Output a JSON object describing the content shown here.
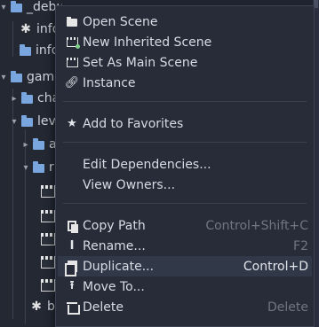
{
  "tree": {
    "rows": [
      {
        "label": "_debug",
        "icon": "folder-icon",
        "arrow": "▾"
      },
      {
        "label": "info",
        "icon": "gear-icon",
        "arrow": ""
      },
      {
        "label": "info",
        "icon": "folder-icon",
        "arrow": ""
      },
      {
        "label": "game",
        "icon": "folder-icon",
        "arrow": "▾"
      },
      {
        "label": "cha",
        "icon": "folder-icon",
        "arrow": "▸"
      },
      {
        "label": "lev",
        "icon": "folder-icon",
        "arrow": "▾"
      },
      {
        "label": "a",
        "icon": "folder-icon",
        "arrow": "▸"
      },
      {
        "label": "r",
        "icon": "folder-icon",
        "arrow": "▾"
      },
      {
        "label": "",
        "icon": "scene-icon",
        "arrow": ""
      },
      {
        "label": "",
        "icon": "scene-icon",
        "arrow": ""
      },
      {
        "label": "",
        "icon": "scene-icon",
        "arrow": ""
      },
      {
        "label": "",
        "icon": "scene-icon",
        "arrow": ""
      },
      {
        "label": "",
        "icon": "scene-icon",
        "arrow": ""
      },
      {
        "label": "b",
        "icon": "gear-icon",
        "arrow": ""
      }
    ]
  },
  "menu": {
    "items": [
      {
        "label": "Open Scene",
        "icon": "folder-open-icon",
        "shortcut": ""
      },
      {
        "label": "New Inherited Scene",
        "icon": "new-inherited-scene-icon",
        "shortcut": ""
      },
      {
        "label": "Set As Main Scene",
        "icon": "main-scene-icon",
        "shortcut": ""
      },
      {
        "label": "Instance",
        "icon": "link-icon",
        "shortcut": ""
      },
      {
        "label": "Add to Favorites",
        "icon": "star-icon",
        "shortcut": ""
      },
      {
        "label": "Edit Dependencies...",
        "icon": "",
        "shortcut": ""
      },
      {
        "label": "View Owners...",
        "icon": "",
        "shortcut": ""
      },
      {
        "label": "Copy Path",
        "icon": "copy-icon",
        "shortcut": "Control+Shift+C"
      },
      {
        "label": "Rename...",
        "icon": "rename-icon",
        "shortcut": "F2"
      },
      {
        "label": "Duplicate...",
        "icon": "duplicate-icon",
        "shortcut": "Control+D"
      },
      {
        "label": "Move To...",
        "icon": "move-icon",
        "shortcut": ""
      },
      {
        "label": "Delete",
        "icon": "trash-icon",
        "shortcut": "Delete"
      }
    ],
    "hovered": "Duplicate..."
  }
}
